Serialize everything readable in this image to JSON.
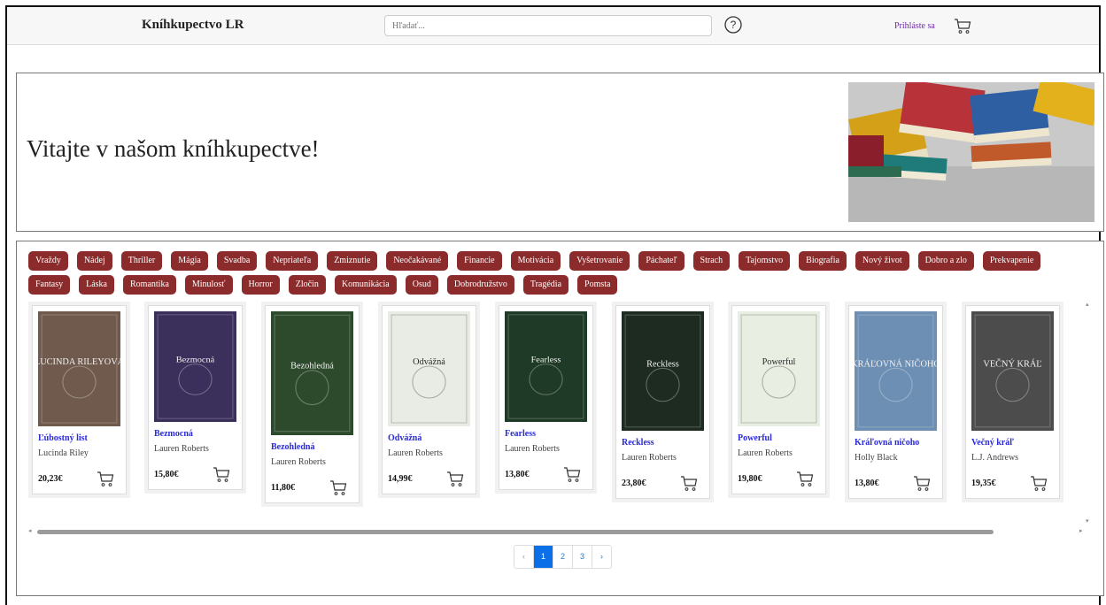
{
  "header": {
    "brand": "Kníhkupectvo LR",
    "search_placeholder": "Hľadať...",
    "login_label": "Prihláste sa"
  },
  "hero": {
    "title": "Vitajte v našom kníhkupectve!"
  },
  "categories": [
    "Vraždy",
    "Nádej",
    "Thriller",
    "Mágia",
    "Svadba",
    "Nepriateľa",
    "Zmiznutie",
    "Neočakávané",
    "Financie",
    "Motivácia",
    "Vyšetrovanie",
    "Páchateľ",
    "Strach",
    "Tajomstvo",
    "Biografia",
    "Nový život",
    "Dobro a zlo",
    "Prekvapenie",
    "Fantasy",
    "Láska",
    "Romantika",
    "Minulosť",
    "Horror",
    "Zločin",
    "Komunikácia",
    "Osud",
    "Dobrodružstvo",
    "Tragédia",
    "Pomsta"
  ],
  "books": [
    {
      "title": "Ľúbostný list",
      "author": "Lucinda Riley",
      "price": "20,23€",
      "cover_text": "LUCINDA RILEYOVÁ",
      "cover_color": "#6f5a4d"
    },
    {
      "title": "Bezmocná",
      "author": "Lauren Roberts",
      "price": "15,80€",
      "cover_text": "Bezmocná",
      "cover_color": "#3b2f5c"
    },
    {
      "title": "Bezohledná",
      "author": "Lauren Roberts",
      "price": "11,80€",
      "cover_text": "Bezohledná",
      "cover_color": "#2d4a2d"
    },
    {
      "title": "Odvážná",
      "author": "Lauren Roberts",
      "price": "14,99€",
      "cover_text": "Odvážná",
      "cover_color": "#e9ece4"
    },
    {
      "title": "Fearless",
      "author": "Lauren Roberts",
      "price": "13,80€",
      "cover_text": "Fearless",
      "cover_color": "#1f3a26"
    },
    {
      "title": "Reckless",
      "author": "Lauren Roberts",
      "price": "23,80€",
      "cover_text": "Reckless",
      "cover_color": "#1e2b20"
    },
    {
      "title": "Powerful",
      "author": "Lauren Roberts",
      "price": "19,80€",
      "cover_text": "Powerful",
      "cover_color": "#e8eee2"
    },
    {
      "title": "Kráľovná ničoho",
      "author": "Holly Black",
      "price": "13,80€",
      "cover_text": "KRÁĽOVNÁ NIČOHO",
      "cover_color": "#6d8fb4"
    },
    {
      "title": "Večný kráľ",
      "author": "L.J. Andrews",
      "price": "19,35€",
      "cover_text": "VEČNÝ KRÁĽ",
      "cover_color": "#4c4c4c"
    }
  ],
  "pagination": {
    "prev": "‹",
    "pages": [
      "1",
      "2",
      "3"
    ],
    "next": "›",
    "active": "1"
  },
  "colors": {
    "tag": "#8b2b2b",
    "link": "#2a2ad6",
    "active_page": "#0b6fe8"
  },
  "icons": {
    "help": "question-circle-icon",
    "cart": "cart-icon"
  }
}
